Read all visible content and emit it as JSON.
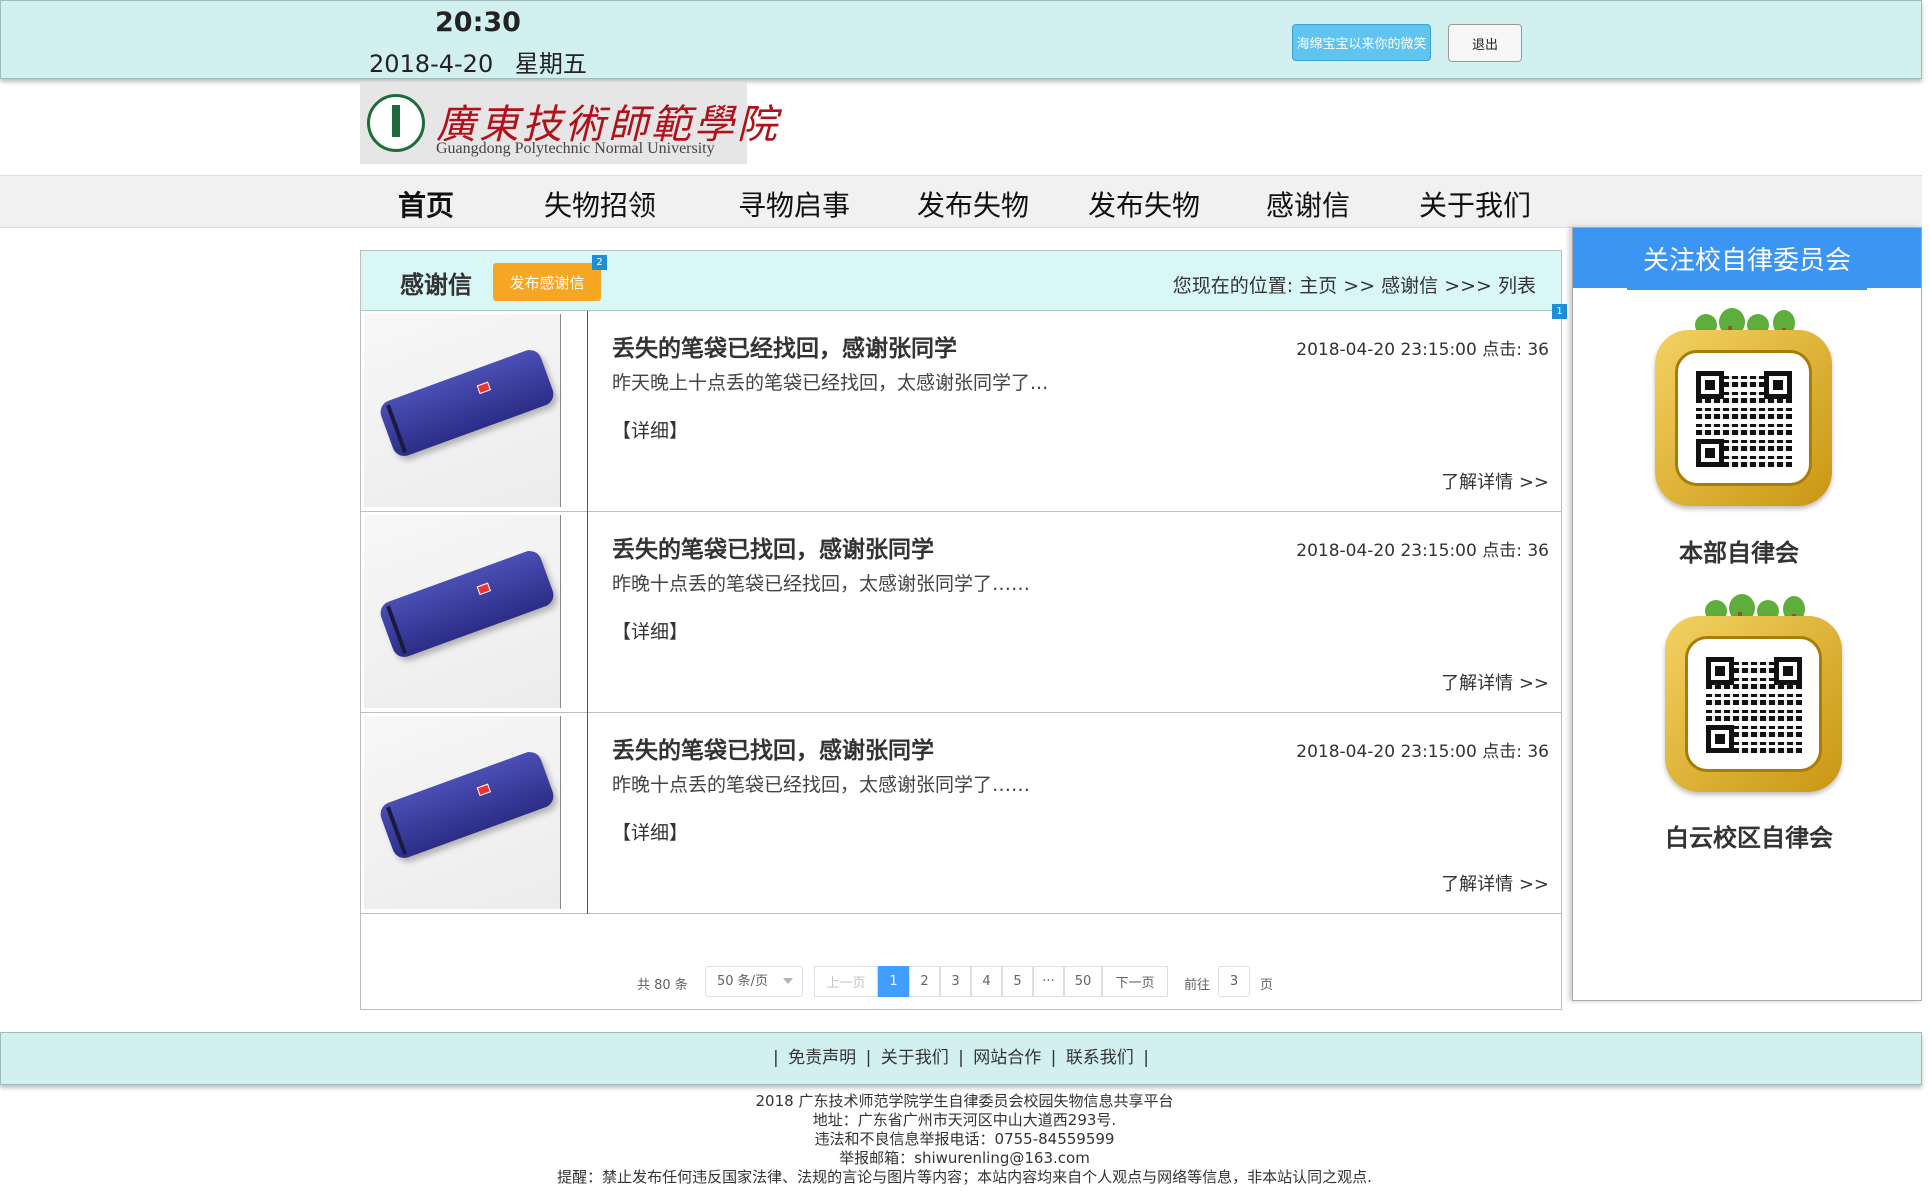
{
  "header": {
    "time": "20:30",
    "date": "2018-4-20",
    "weekday": "星期五",
    "user_button": "海绵宝宝以来你的微笑",
    "logout_button": "退出"
  },
  "logo": {
    "name_cn": "廣東技術師範學院",
    "name_en": "Guangdong Polytechnic Normal University"
  },
  "nav": {
    "items": [
      "首页",
      "失物招领",
      "寻物启事",
      "发布失物",
      "发布失物",
      "感谢信",
      "关于我们"
    ]
  },
  "main": {
    "title": "感谢信",
    "publish_button": "发布感谢信",
    "badge_publish": "2",
    "badge_list": "1",
    "breadcrumb": "您现在的位置:  主页 >> 感谢信 >>> 列表",
    "items": [
      {
        "title": "丢失的笔袋已经找回，感谢张同学",
        "datetime": "2018-04-20 23:15:00",
        "clicks_label": "点击:",
        "clicks": "36",
        "desc": "昨天晚上十点丢的笔袋已经找回，太感谢张同学了...",
        "detail": "【详细】",
        "more": "了解详情    >>"
      },
      {
        "title": "丢失的笔袋已找回，感谢张同学",
        "datetime": "2018-04-20 23:15:00",
        "clicks_label": "点击:",
        "clicks": "36",
        "desc": "昨晚十点丢的笔袋已经找回，太感谢张同学了……",
        "detail": "【详细】",
        "more": "了解详情    >>"
      },
      {
        "title": "丢失的笔袋已找回，感谢张同学",
        "datetime": "2018-04-20 23:15:00",
        "clicks_label": "点击:",
        "clicks": "36",
        "desc": "昨晚十点丢的笔袋已经找回，太感谢张同学了……",
        "detail": "【详细】",
        "more": "了解详情    >>"
      }
    ]
  },
  "pagination": {
    "total": "共 80 条",
    "page_size": "50 条/页",
    "prev": "上一页",
    "pages": [
      "1",
      "2",
      "3",
      "4",
      "5",
      "···",
      "50"
    ],
    "current": "1",
    "next": "下一页",
    "goto_label": "前往",
    "goto_value": "3",
    "goto_unit": "页"
  },
  "sidebar": {
    "title": "关注校自律委员会",
    "qr1_label": "本部自律会",
    "qr2_label": "白云校区自律会"
  },
  "footer": {
    "links": [
      "免责声明",
      "关于我们",
      "网站合作",
      "联系我们"
    ],
    "lines": [
      "2018 广东技术师范学院学生自律委员会校园失物信息共享平台",
      "地址：广东省广州市天河区中山大道西293号.",
      "违法和不良信息举报电话：0755-84559599",
      "举报邮箱：shiwurenling@163.com",
      "提醒：禁止发布任何违反国家法律、法规的言论与图片等内容；本站内容均来自个人观点与网络等信息，非本站认同之观点."
    ]
  },
  "colors": {
    "header_bg": "#d3f0f0",
    "accent_blue": "#3b95f3",
    "publish_orange": "#f5a623",
    "pager_active": "#409eff"
  }
}
